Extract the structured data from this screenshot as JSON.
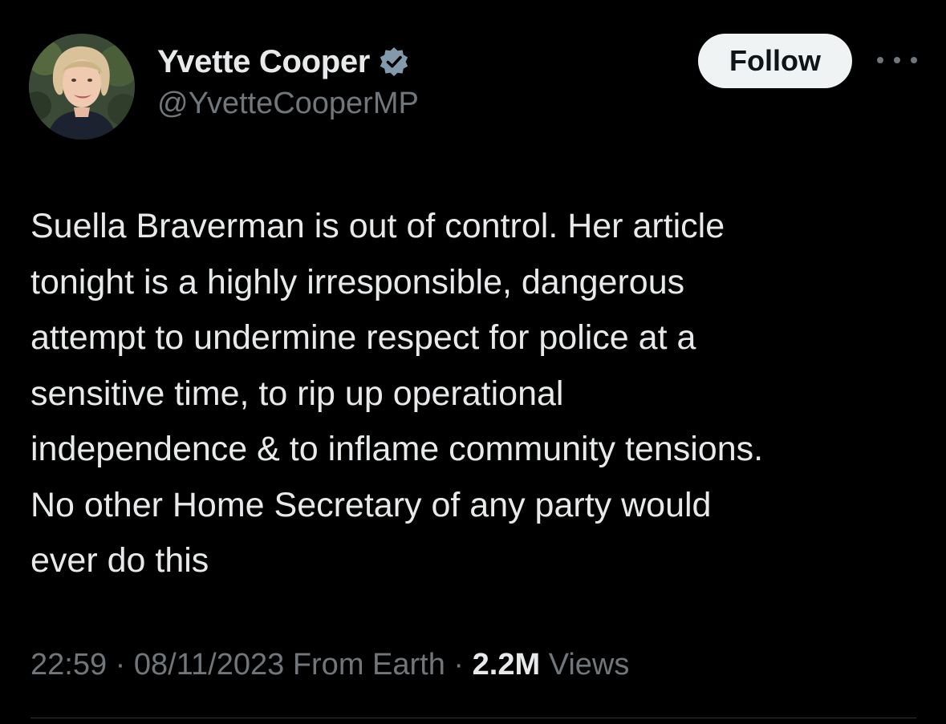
{
  "author": {
    "display_name": "Yvette Cooper",
    "handle": "@YvetteCooperMP",
    "verified_icon": "verified-badge-icon",
    "avatar": "profile-photo"
  },
  "actions": {
    "follow_label": "Follow",
    "more_icon": "more-options-icon"
  },
  "tweet": {
    "lines": [
      "Suella Braverman is out of control. Her article",
      "tonight is a highly irresponsible, dangerous",
      "attempt to undermine respect for police at a",
      "sensitive time, to rip up operational",
      "independence & to inflame community tensions.",
      "No other Home Secretary of any party would",
      "ever do this"
    ]
  },
  "meta": {
    "time": "22:59",
    "separator": "·",
    "date": "08/11/2023",
    "source": "From Earth",
    "views_count": "2.2M",
    "views_label": "Views"
  },
  "colors": {
    "background": "#000000",
    "primary_text": "#e7e9ea",
    "secondary_text": "#71767b",
    "verified_badge": "#829aab",
    "follow_button_bg": "#eff3f4"
  }
}
